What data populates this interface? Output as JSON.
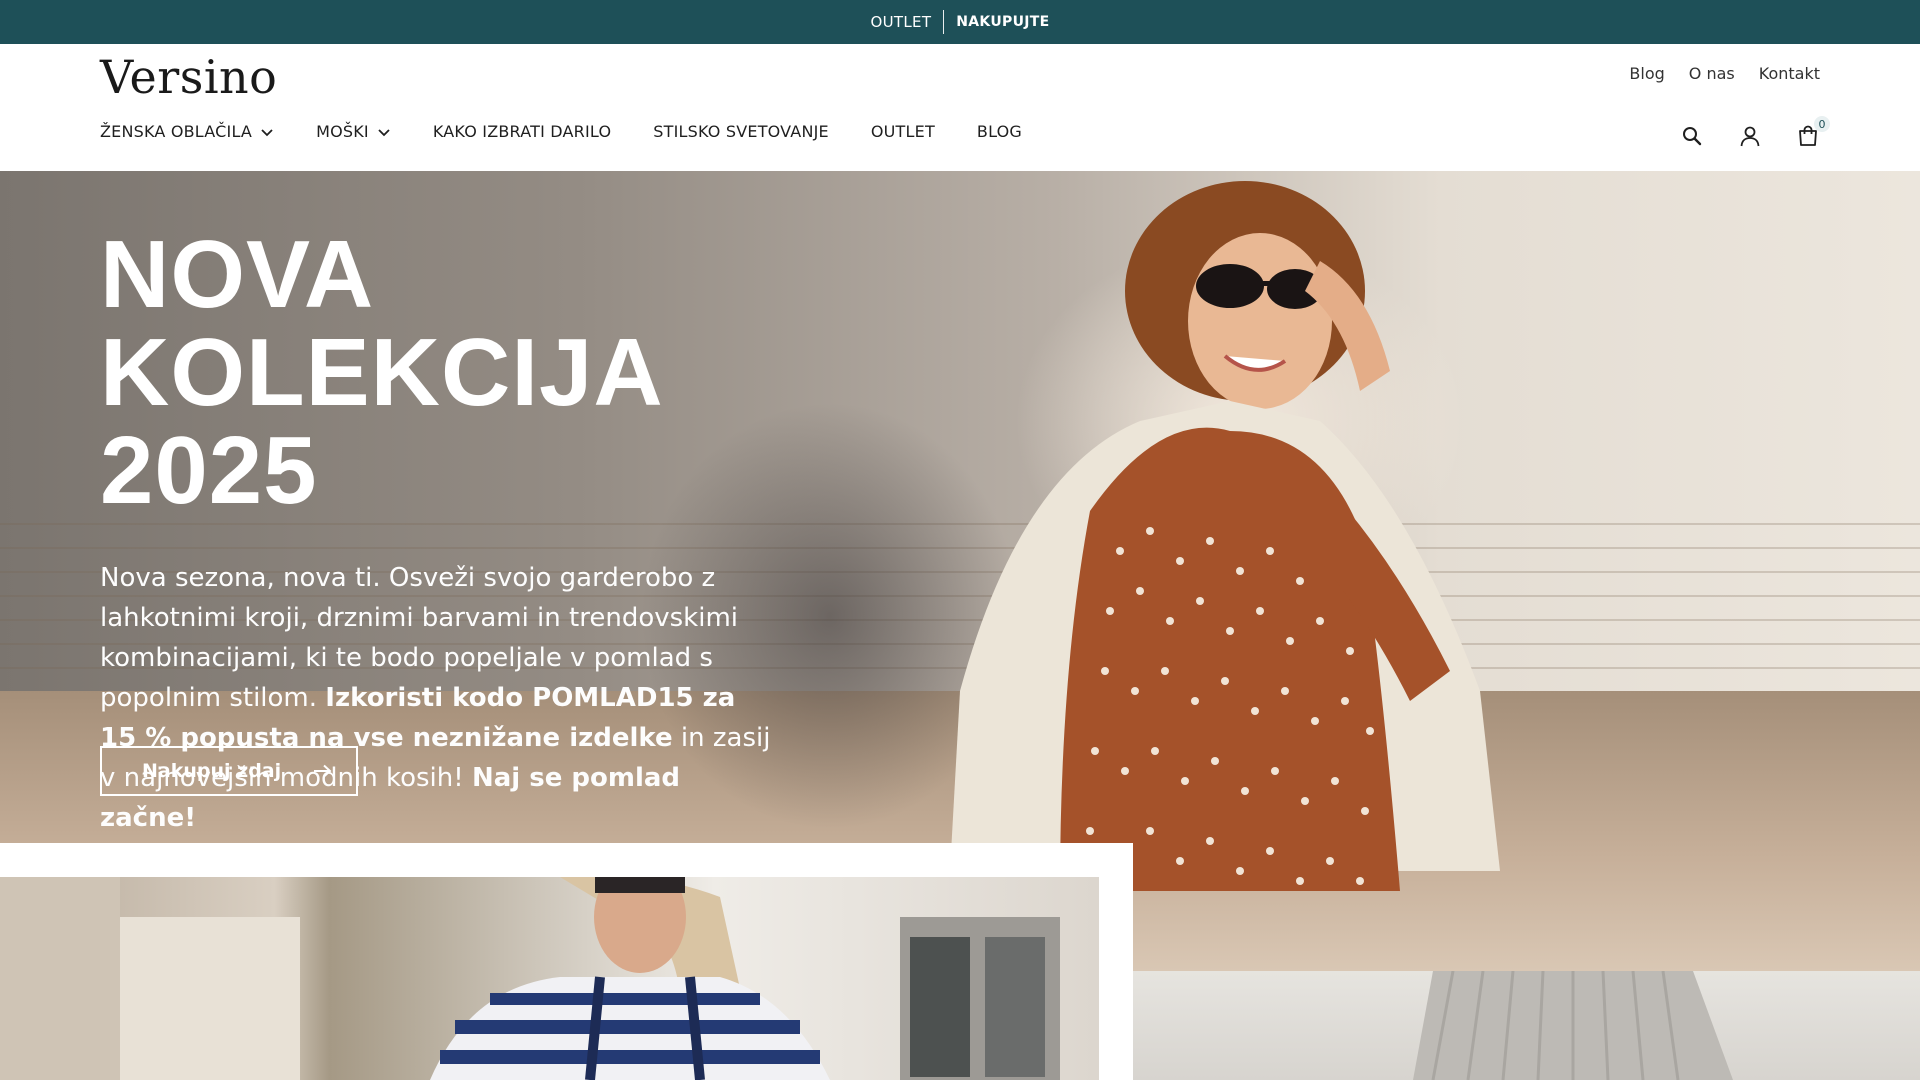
{
  "announcement": {
    "left_label": "OUTLET",
    "cta_label": "NAKUPUJTE"
  },
  "header": {
    "logo": "Versino",
    "util_links": [
      "Blog",
      "O nas",
      "Kontakt"
    ],
    "nav": [
      {
        "label": "ŽENSKA OBLAČILA",
        "has_dropdown": true
      },
      {
        "label": "MOŠKI",
        "has_dropdown": true
      },
      {
        "label": "KAKO IZBRATI DARILO",
        "has_dropdown": false
      },
      {
        "label": "STILSKO SVETOVANJE",
        "has_dropdown": false
      },
      {
        "label": "OUTLET",
        "has_dropdown": false
      },
      {
        "label": "BLOG",
        "has_dropdown": false
      }
    ],
    "icons": [
      "search-icon",
      "account-icon",
      "cart-icon"
    ],
    "cart_count": "0"
  },
  "hero": {
    "title_line1": "NOVA KOLEKCIJA",
    "title_line2": "2025",
    "body_part1": "Nova sezona, nova ti. Osveži svojo garderobo z lahkotnimi kroji, drznimi barvami in trendovskimi kombinacijami, ki te bodo popeljale v pomlad s popolnim stilom. ",
    "body_bold1": "Izkoristi kodo POMLAD15 za 15 % popusta na vse neznižane izdelke",
    "body_part2": " in zasij v najnovejših modnih kosih! ",
    "body_bold2": "Naj se pomlad začne!",
    "button_label": "Nakupuj zdaj"
  },
  "colors": {
    "announcement_bg": "#1e5058",
    "text_dark": "#1f1f1f",
    "hero_text": "#ffffff"
  }
}
